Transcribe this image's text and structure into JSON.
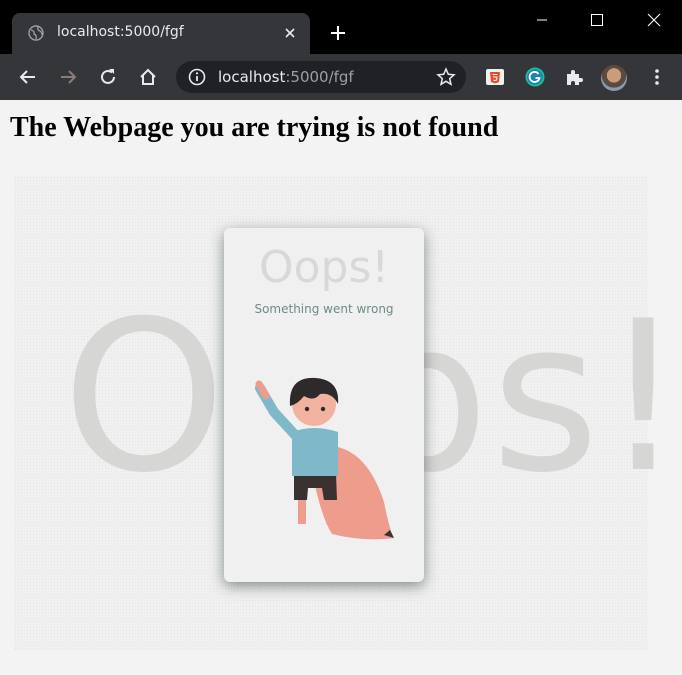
{
  "browser": {
    "tab_title": "localhost:5000/fgf",
    "url_host": "localhost",
    "url_path": ":5000/fgf",
    "icons": [
      "globe-icon",
      "close-icon",
      "plus-icon",
      "minimize-icon",
      "maximize-icon",
      "window-close-icon",
      "back-icon",
      "forward-icon",
      "reload-icon",
      "home-icon",
      "info-icon",
      "star-icon",
      "extension-html5-icon",
      "extension-grammarly-icon",
      "puzzle-icon",
      "avatar",
      "kebab-menu-icon"
    ]
  },
  "page": {
    "heading": "The Webpage you are trying is not found",
    "background_text": "Oops!",
    "card_title": "Oops!",
    "card_subtitle": "Something went wrong"
  },
  "colors": {
    "chrome_dark": "#35363a",
    "page_bg": "#f3f3f3",
    "faded_text": "#d6d6d4",
    "subtitle": "#6e8a8a",
    "cape": "#ee9c8c",
    "shirt": "#7fb9c9"
  }
}
